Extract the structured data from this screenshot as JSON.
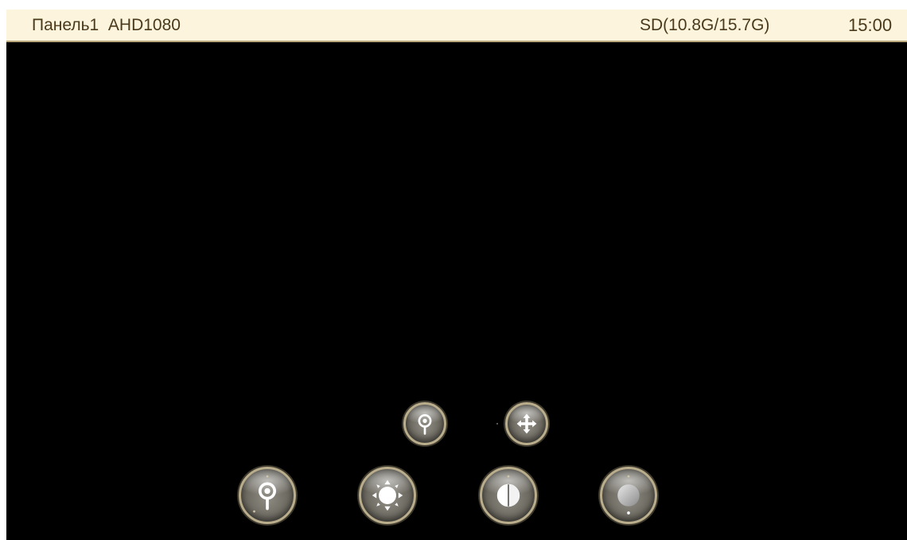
{
  "status_bar": {
    "panel_label": "Панель1",
    "resolution_label": "AHD1080",
    "storage_label": "SD(10.8G/15.7G)",
    "clock": "15:00"
  },
  "colors": {
    "status_bar_bg": "#fcf4dc",
    "status_bar_text": "#4a3a1c",
    "video_bg": "#000000",
    "control_ring": "#b9ad8c"
  },
  "controls": {
    "top_row": [
      {
        "name": "zoom",
        "icon": "magnifier-icon"
      },
      {
        "name": "move",
        "icon": "move-arrows-icon"
      }
    ],
    "bottom_row": [
      {
        "name": "zoom",
        "icon": "magnifier-icon"
      },
      {
        "name": "brightness",
        "icon": "sun-icon"
      },
      {
        "name": "contrast",
        "icon": "contrast-icon"
      },
      {
        "name": "saturation",
        "icon": "saturation-icon"
      }
    ]
  }
}
